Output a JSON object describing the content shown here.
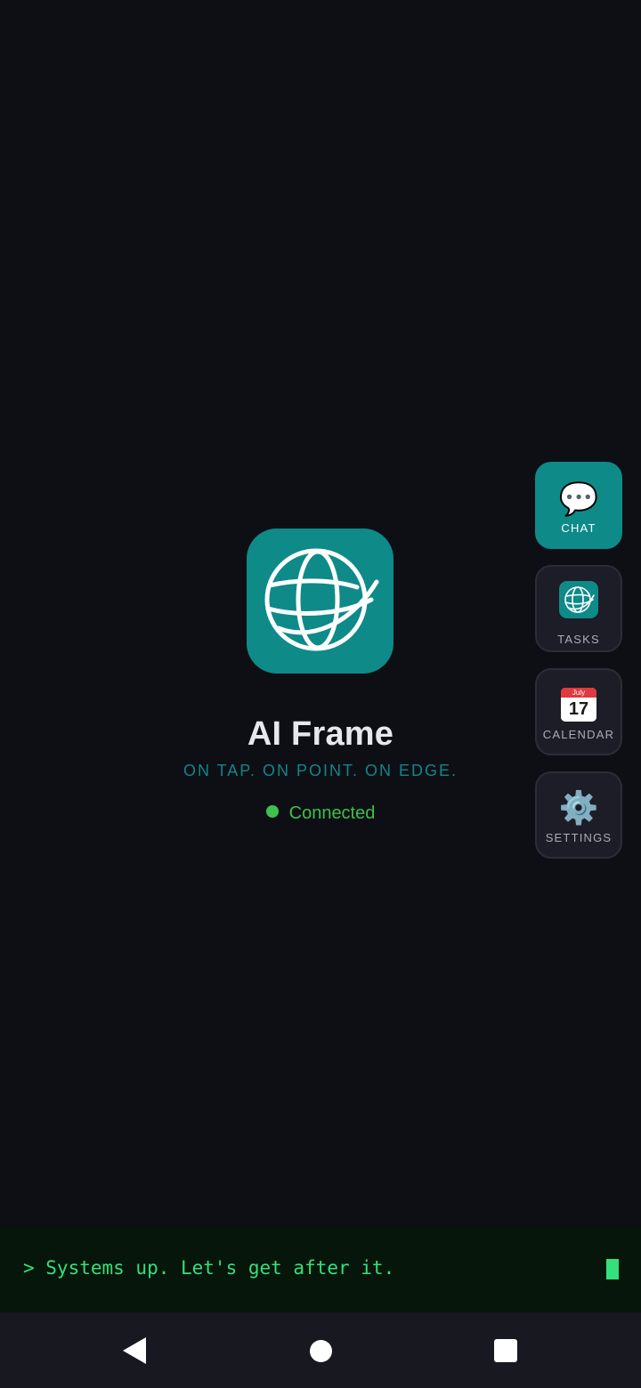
{
  "app": {
    "title": "AI Frame",
    "tagline": "ON TAP. ON POINT. ON EDGE.",
    "status": "Connected",
    "logo_icon": "globe-orbit-icon",
    "brand_color": "#0e8a89",
    "status_color": "#3fbf4c"
  },
  "dock": {
    "items": [
      {
        "label": "CHAT",
        "icon": "speech-bubble-icon",
        "glyph": "💬",
        "active": true
      },
      {
        "label": "TASKS",
        "icon": "globe-orbit-icon",
        "active": false
      },
      {
        "label": "CALENDAR",
        "icon": "calendar-icon",
        "month": "July",
        "day": "17",
        "active": false
      },
      {
        "label": "SETTINGS",
        "icon": "gear-icon",
        "glyph": "⚙️",
        "active": false
      }
    ]
  },
  "terminal": {
    "message": "> Systems up. Let's get after it.",
    "text_color": "#33e07a"
  },
  "navbar": {
    "back_icon": "back-triangle-icon",
    "home_icon": "home-circle-icon",
    "recents_icon": "recents-square-icon"
  }
}
